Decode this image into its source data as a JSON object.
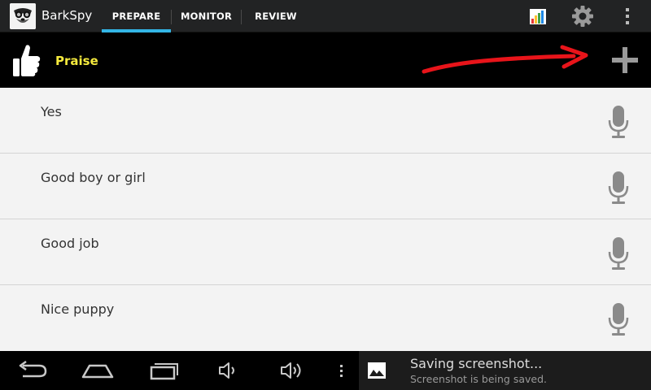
{
  "app": {
    "title": "BarkSpy",
    "tabs": [
      {
        "label": "PREPARE",
        "selected": true
      },
      {
        "label": "MONITOR",
        "selected": false
      },
      {
        "label": "REVIEW",
        "selected": false
      }
    ],
    "actions": [
      "chart-icon",
      "gear-icon",
      "overflow-icon"
    ],
    "accent_color": "#33b5e5"
  },
  "category": {
    "title": "Praise",
    "title_color": "#f5ea3d",
    "icon": "thumbs-up-icon",
    "add_icon": "plus-icon",
    "annotation": "red-arrow-icon"
  },
  "commands": [
    {
      "label": "Yes",
      "icon": "microphone-icon"
    },
    {
      "label": "Good boy or girl",
      "icon": "microphone-icon"
    },
    {
      "label": "Good job",
      "icon": "microphone-icon"
    },
    {
      "label": "Nice puppy",
      "icon": "microphone-icon"
    }
  ],
  "system_bar": {
    "buttons": [
      "back-icon",
      "home-icon",
      "recent-apps-icon",
      "volume-down-icon",
      "volume-up-icon",
      "menu-icon"
    ],
    "notification": {
      "title": "Saving screenshot...",
      "subtitle": "Screenshot is being saved.",
      "icon": "image-icon"
    }
  }
}
